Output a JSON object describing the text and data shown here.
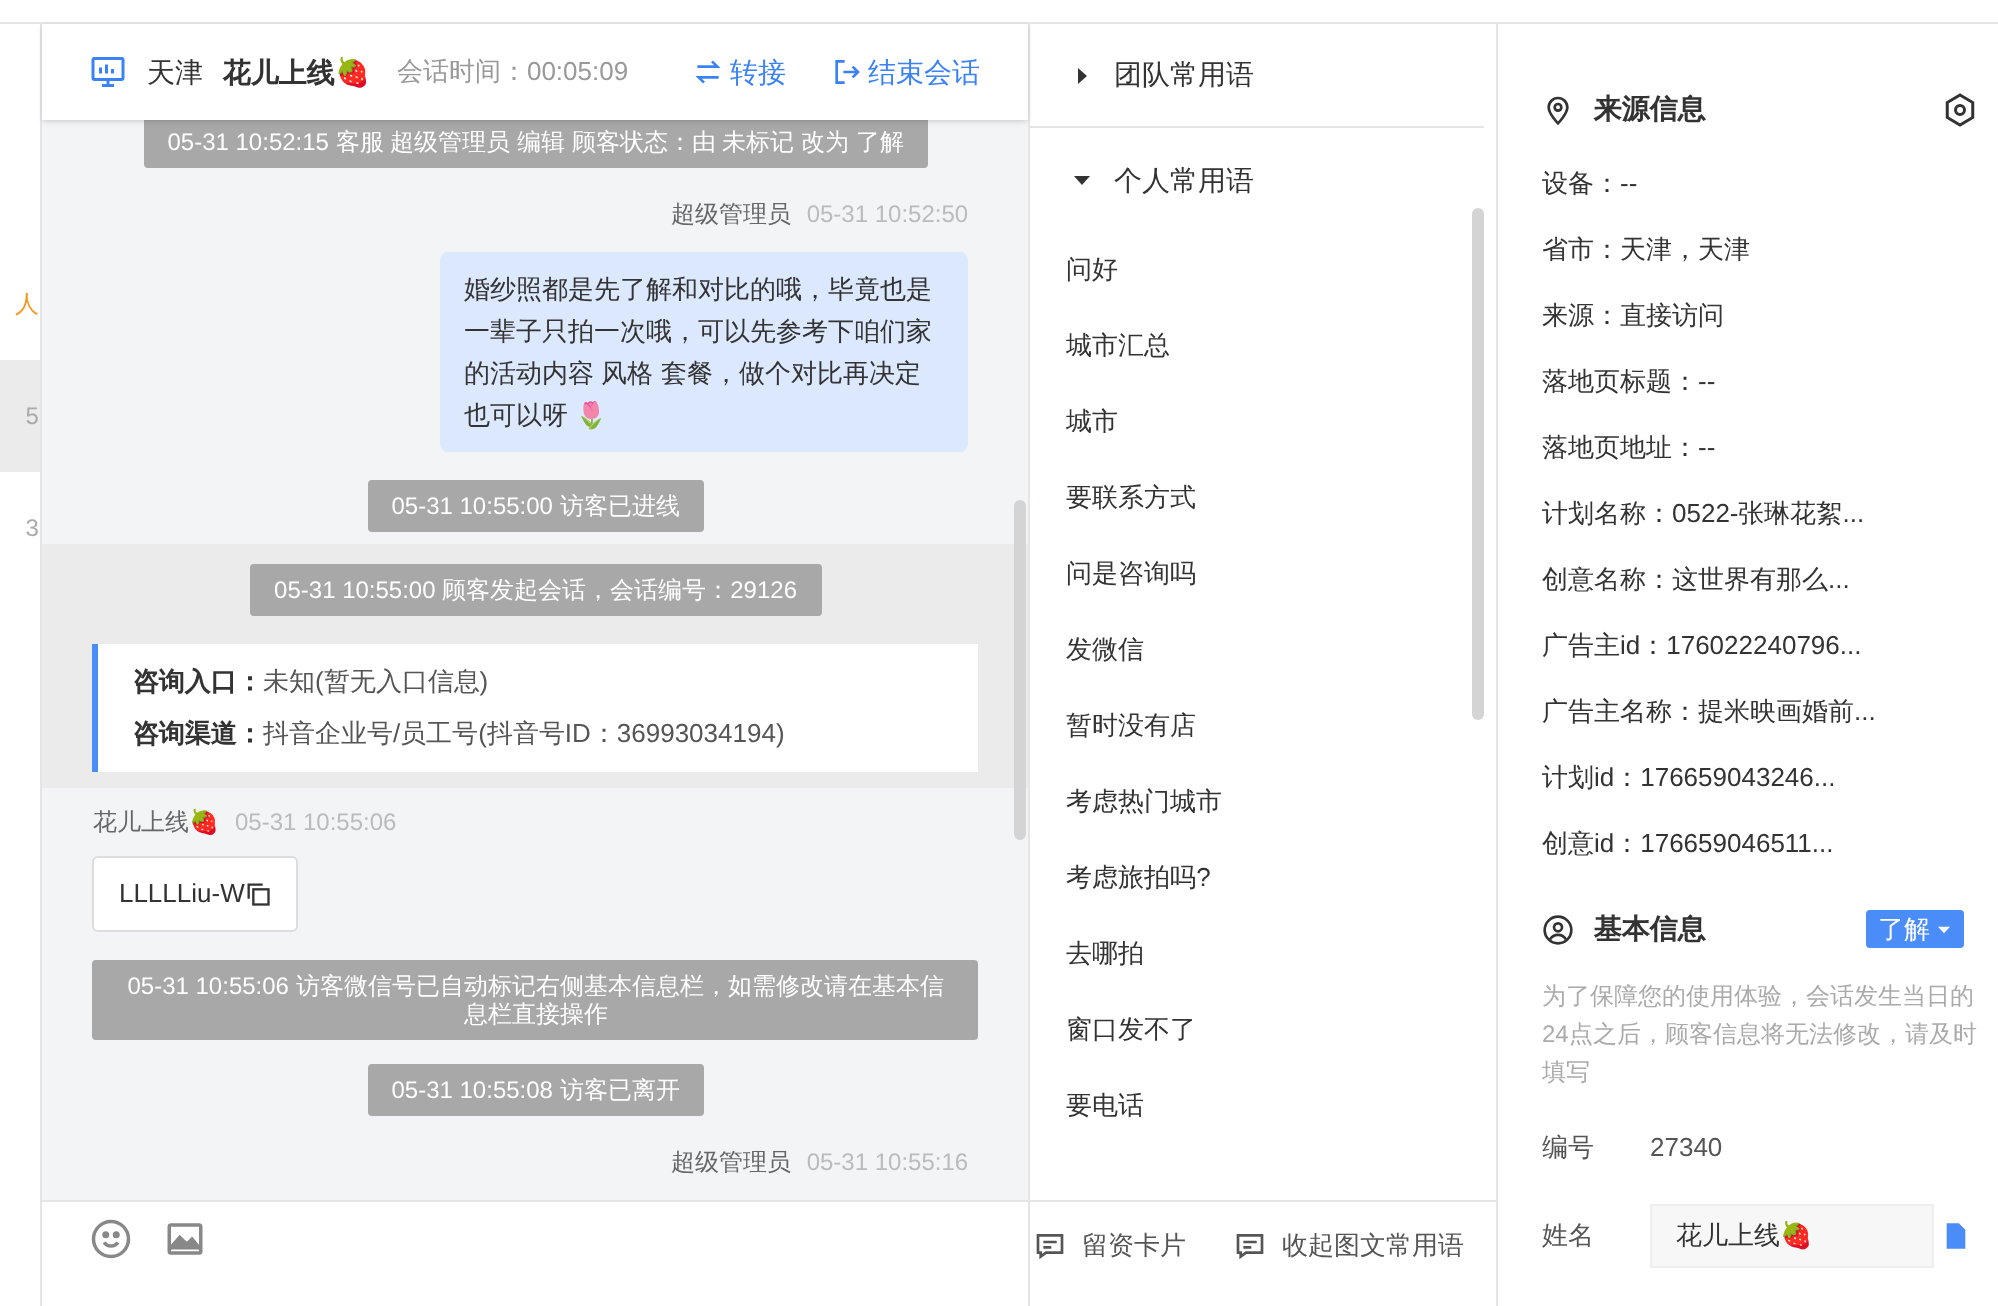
{
  "left_strip": {
    "items": [
      {
        "text": "人",
        "selected": false,
        "kind": "accent"
      },
      {
        "text": "5",
        "selected": true,
        "kind": "plain"
      },
      {
        "text": "3",
        "selected": false,
        "kind": "plain"
      }
    ]
  },
  "chat_header": {
    "city": "天津",
    "visitor": "花儿上线🍓",
    "duration_label": "会话时间：",
    "duration": "00:05:09",
    "actions": [
      {
        "label": "转接",
        "kind": "transfer"
      },
      {
        "label": "结束会话",
        "kind": "end"
      }
    ]
  },
  "messages": [
    {
      "kind": "system",
      "text": "05-31 10:52:15 客服 超级管理员 编辑 顾客状态：由 未标记 改为 了解"
    },
    {
      "kind": "outgoing",
      "sender": "超级管理员",
      "time": "05-31 10:52:50",
      "text": "婚纱照都是先了解和对比的哦，毕竟也是一辈子只拍一次哦，可以先参考下咱们家的活动内容 风格 套餐，做个对比再决定也可以呀 🌷"
    },
    {
      "kind": "system",
      "text": "05-31 10:55:00 访客已进线"
    },
    {
      "kind": "session_start",
      "text": "05-31 10:55:00 顾客发起会话，会话编号：29126",
      "rows": [
        {
          "label": "咨询入口：",
          "value": "未知(暂无入口信息)"
        },
        {
          "label": "咨询渠道：",
          "value": "抖音企业号/员工号(抖音号ID：36993034194)"
        }
      ]
    },
    {
      "kind": "incoming_card",
      "sender": "花儿上线🍓",
      "time": "05-31 10:55:06",
      "text": "LLLLLiu-W"
    },
    {
      "kind": "system_wide",
      "text": "05-31 10:55:06 访客微信号已自动标记右侧基本信息栏，如需修改请在基本信息栏直接操作"
    },
    {
      "kind": "system",
      "text": "05-31 10:55:08 访客已离开"
    },
    {
      "kind": "outgoing_meta",
      "sender": "超级管理员",
      "time": "05-31 10:55:16"
    }
  ],
  "composer": {
    "tools": [
      {
        "kind": "emoji"
      },
      {
        "kind": "image"
      }
    ],
    "actions": [
      {
        "label": "留资卡片"
      },
      {
        "label": "收起图文常用语"
      }
    ]
  },
  "quick_phrases": {
    "groups": [
      {
        "title": "团队常用语",
        "expanded": false
      },
      {
        "title": "个人常用语",
        "expanded": true,
        "items": [
          "问好",
          "城市汇总",
          "城市",
          "要联系方式",
          "问是咨询吗",
          "发微信",
          "暂时没有店",
          "考虑热门城市",
          "考虑旅拍吗?",
          "去哪拍",
          "窗口发不了",
          "要电话"
        ]
      }
    ]
  },
  "source_info": {
    "title": "来源信息",
    "rows": [
      "设备：--",
      "省市：天津，天津",
      "来源：直接访问",
      "落地页标题：--",
      "落地页地址：--",
      "计划名称：0522-张琳花絮...",
      "创意名称：这世界有那么...",
      "广告主id：176022240796...",
      "广告主名称：提米映画婚前...",
      "计划id：176659043246...",
      "创意id：176659046511..."
    ]
  },
  "basic_info": {
    "title": "基本信息",
    "status": "了解",
    "notice": "为了保障您的使用体验，会话发生当日的24点之后，顾客信息将无法修改，请及时填写",
    "fields": [
      {
        "label": "编号",
        "value": "27340",
        "kind": "text"
      },
      {
        "label": "姓名",
        "value": "花儿上线🍓",
        "kind": "input"
      }
    ]
  }
}
